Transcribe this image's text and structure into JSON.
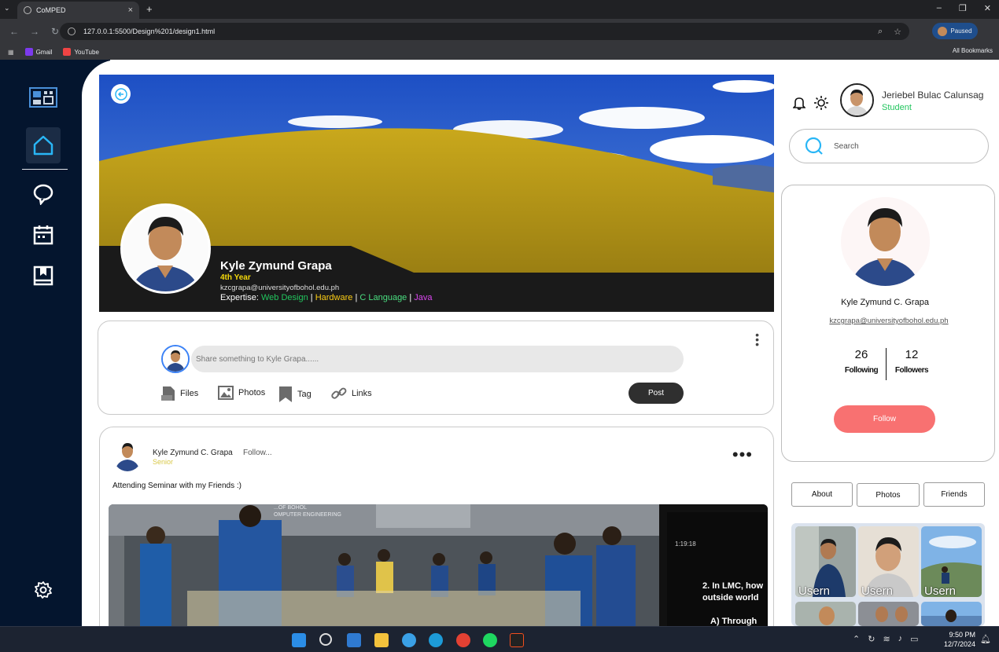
{
  "browser": {
    "tab_title": "CoMPED",
    "url": "127.0.0.1:5500/Design%201/design1.html",
    "profile_status": "Paused",
    "bookmarks": [
      {
        "label": "Gmail"
      },
      {
        "label": "YouTube"
      }
    ],
    "all_bookmarks": "All Bookmarks"
  },
  "profile": {
    "name": "Kyle Zymund Grapa",
    "year": "4th Year",
    "email": "kzcgrapa@universityofbohol.edu.ph",
    "expertise_label": "Expertise:",
    "expertise": [
      {
        "label": "Web Design",
        "color": "#22c55e"
      },
      {
        "label": "Hardware",
        "color": "#facc15"
      },
      {
        "label": "C Language",
        "color": "#4ade80"
      },
      {
        "label": "Java",
        "color": "#d946ef"
      }
    ],
    "separator": "|"
  },
  "composer": {
    "placeholder": "Share something to Kyle Grapa......",
    "actions": [
      {
        "label": "Files"
      },
      {
        "label": "Photos"
      },
      {
        "label": "Tag"
      },
      {
        "label": "Links"
      }
    ],
    "post_label": "Post"
  },
  "post": {
    "author": "Kyle Zymund C. Grapa",
    "follow": "Follow...",
    "role": "Senior",
    "text": "Attending Seminar with my Friends :)",
    "image_banner": "...OF BOHOL\nOMPUTER ENGINEERING",
    "slide_text": "2. In LMC, how\noutside world",
    "slide_text2": "A) Through",
    "slide_timer": "1:19:18"
  },
  "header": {
    "user_name": "Jeriebel Bulac Calunsag",
    "user_role": "Student",
    "search_placeholder": "Search"
  },
  "card": {
    "name": "Kyle Zymund C. Grapa",
    "email": "kzcgrapa@universityofbohol.edu.ph",
    "following_count": "26",
    "following_label": "Following",
    "followers_count": "12",
    "followers_label": "Followers",
    "follow_button": "Follow"
  },
  "tabs": [
    {
      "label": "About"
    },
    {
      "label": "Photos"
    },
    {
      "label": "Friends"
    }
  ],
  "friends": [
    {
      "label": "Usern ame"
    },
    {
      "label": "Usern ame"
    },
    {
      "label": "Usern ame"
    }
  ],
  "taskbar": {
    "time": "9:50 PM",
    "date": "12/7/2024"
  }
}
